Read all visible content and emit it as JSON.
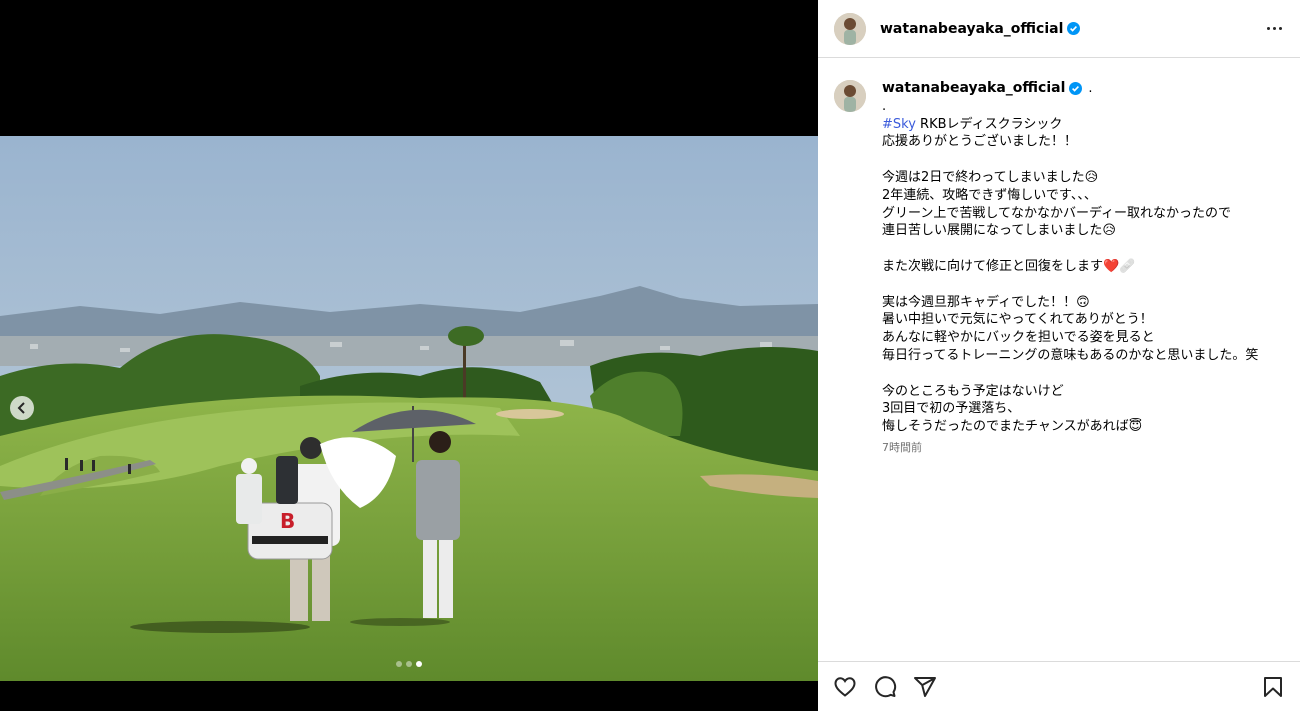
{
  "post": {
    "username": "watanabeayaka_official",
    "caption_username": "watanabeayaka_official",
    "caption_suffix": ".",
    "caption_first": ".",
    "hashtag": "#Sky",
    "caption_after_tag": " RKBレディスクラシック",
    "caption_rest": "応援ありがとうございました！！\n\n今週は2日で終わってしまいました😥\n2年連続、攻略できず悔しいです、、、\nグリーン上で苦戦してなかなかバーディー取れなかったので\n連日苦しい展開になってしまいました😥\n\nまた次戦に向けて修正と回復をします❤️🩹\n\n実は今週旦那キャディでした！！🙃\n暑い中担いで元気にやってくれてありがとう！\nあんなに軽やかにバックを担いでる姿を見ると\n毎日行ってるトレーニングの意味もあるのかなと思いました。笑\n\n今のところもう予定はないけど\n3回目で初の予選落ち、\n悔しそうだったのでまたチャンスがあれば😇",
    "time_ago": "7時間前"
  },
  "carousel": {
    "count": 3,
    "active_index": 2
  },
  "icons": {
    "verified": "verified-badge-icon",
    "more": "more-options-icon",
    "prev": "chevron-left-icon",
    "like": "heart-icon",
    "comment": "comment-icon",
    "share": "share-icon",
    "save": "bookmark-icon"
  },
  "colors": {
    "verified": "#0095f6",
    "hashtag": "#3b5bdb",
    "timestamp": "#737373"
  }
}
